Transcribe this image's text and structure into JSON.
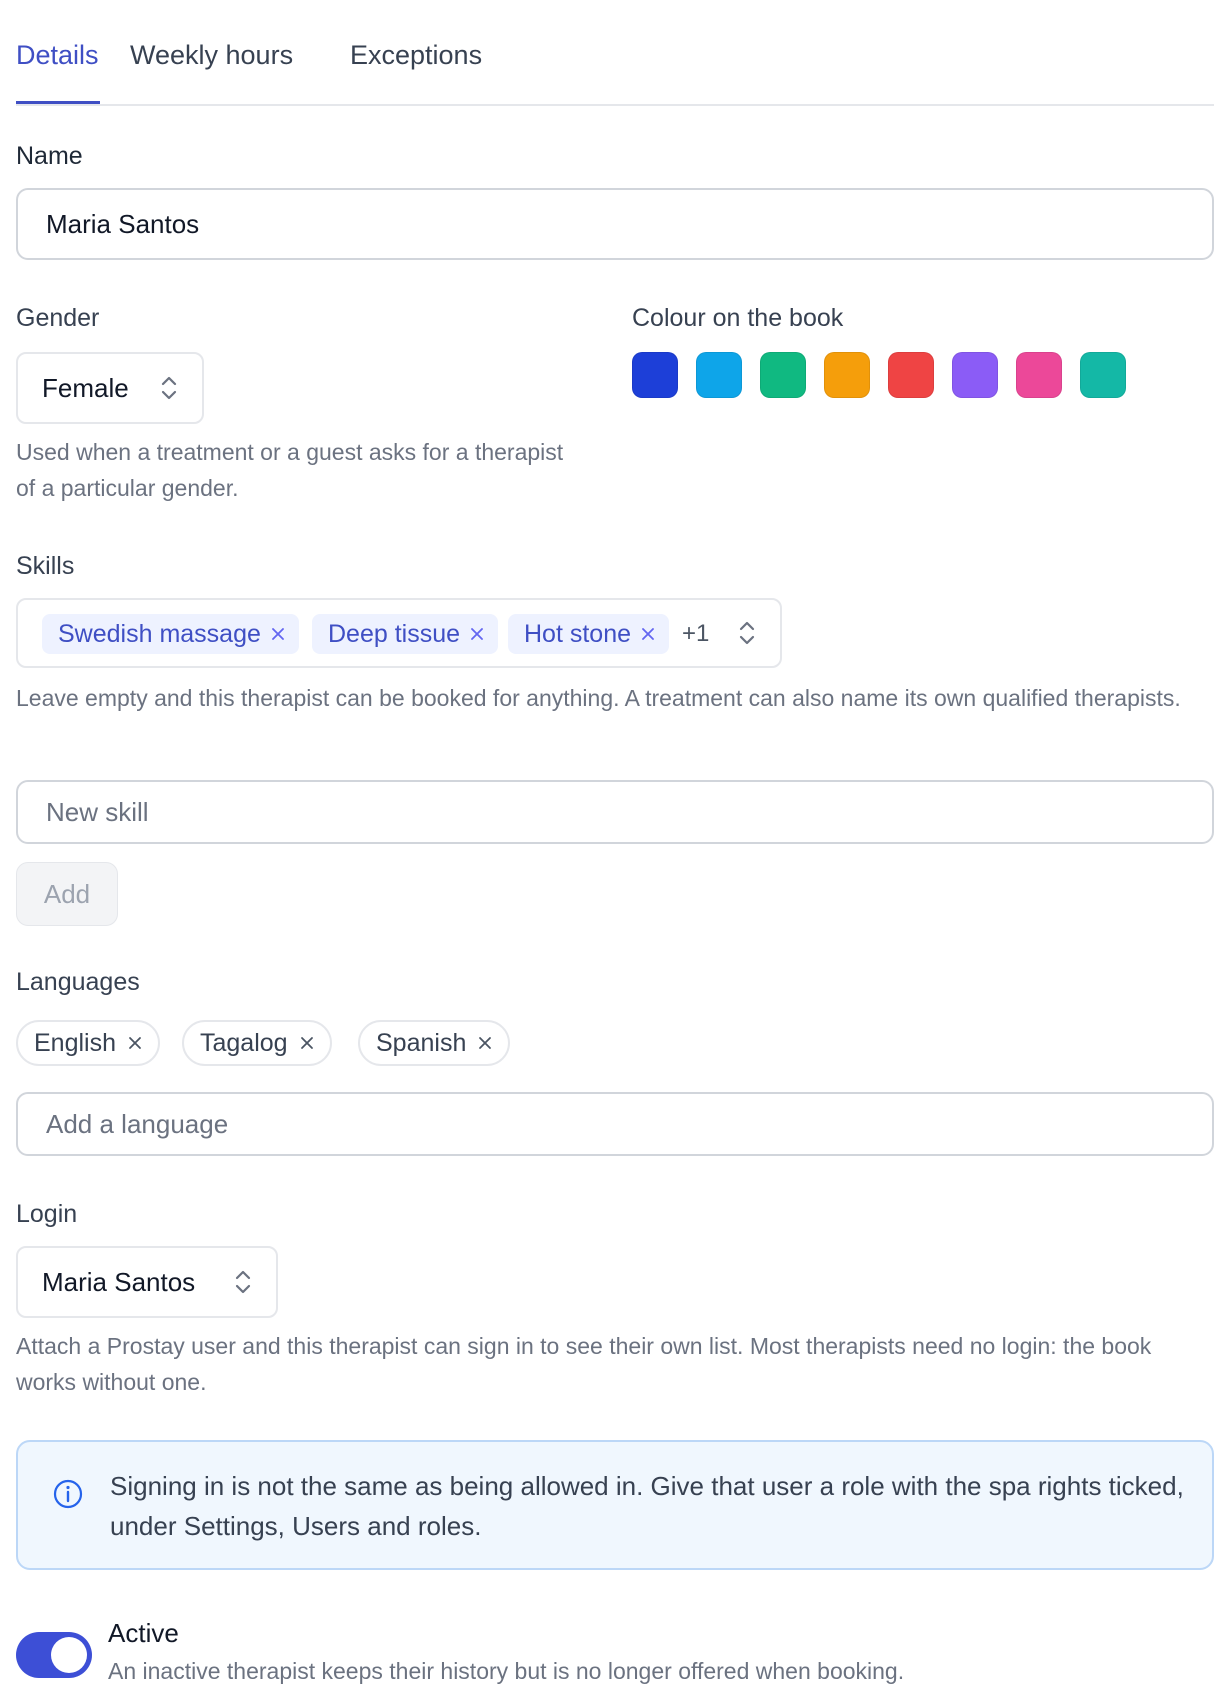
{
  "tabs": [
    {
      "label": "Details",
      "active": true
    },
    {
      "label": "Weekly hours",
      "active": false
    },
    {
      "label": "Exceptions",
      "active": false
    }
  ],
  "name": {
    "label": "Name",
    "value": "Maria Santos"
  },
  "gender": {
    "label": "Gender",
    "value": "Female",
    "help": "Used when a treatment or a guest asks for a therapist of a particular gender."
  },
  "colour": {
    "label": "Colour on the book",
    "swatches": [
      "#1d3fd8",
      "#0ea5e9",
      "#10b981",
      "#f59e0b",
      "#ef4444",
      "#8b5cf6",
      "#ec4899",
      "#14b8a6"
    ]
  },
  "skills": {
    "label": "Skills",
    "chips": [
      "Swedish massage",
      "Deep tissue",
      "Hot stone"
    ],
    "more": "+1",
    "help": "Leave empty and this therapist can be booked for anything. A treatment can also name its own qualified therapists.",
    "new_placeholder": "New skill",
    "add_label": "Add"
  },
  "languages": {
    "label": "Languages",
    "items": [
      "English",
      "Tagalog",
      "Spanish"
    ],
    "placeholder": "Add a language"
  },
  "login": {
    "label": "Login",
    "value": "Maria Santos",
    "help": "Attach a Prostay user and this therapist can sign in to see their own list. Most therapists need no login: the book works without one."
  },
  "info": {
    "text": "Signing in is not the same as being allowed in. Give that user a role with the spa rights ticked, under Settings, Users and roles."
  },
  "active": {
    "label": "Active",
    "on": true,
    "help": "An inactive therapist keeps their history but is no longer offered when booking."
  },
  "colors": {
    "accent": "#3f4fc4",
    "toggle": "#3d4fd6",
    "info_bg": "#f0f7fe",
    "info_border": "#bcd7f7"
  }
}
